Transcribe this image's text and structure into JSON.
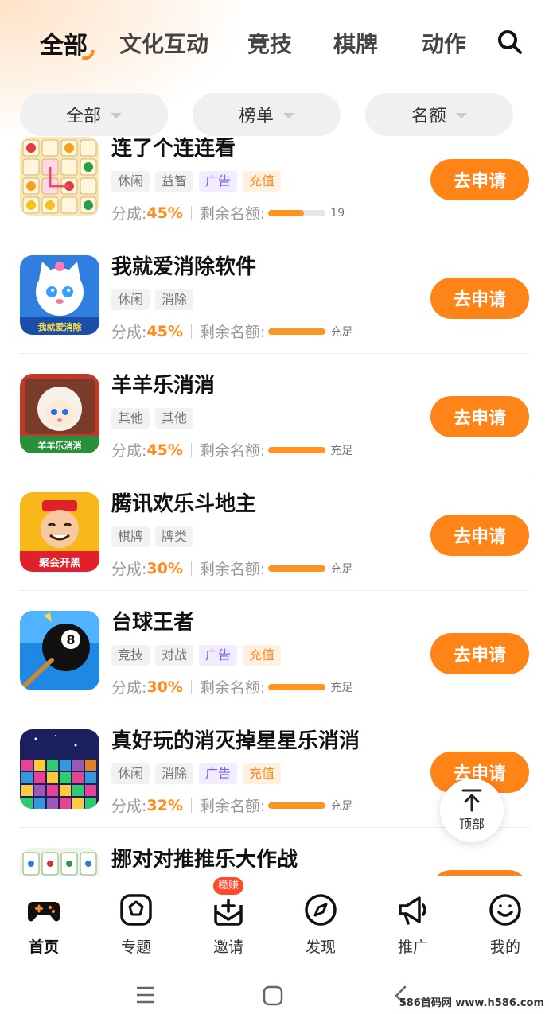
{
  "category_tabs": [
    {
      "label": "全部",
      "active": true
    },
    {
      "label": "文化互动",
      "active": false
    },
    {
      "label": "竞技",
      "active": false
    },
    {
      "label": "棋牌",
      "active": false
    },
    {
      "label": "动作",
      "active": false
    }
  ],
  "filters": [
    {
      "label": "全部"
    },
    {
      "label": "榜单"
    },
    {
      "label": "名额"
    }
  ],
  "meta_labels": {
    "share": "分成:",
    "quota": "剩余名额:"
  },
  "apply_label": "去申请",
  "games": [
    {
      "name": "连了个连连看",
      "icon": "link-match-game-icon",
      "tags": [
        {
          "text": "休闲",
          "type": "normal"
        },
        {
          "text": "益智",
          "type": "normal"
        },
        {
          "text": "广告",
          "type": "ad"
        },
        {
          "text": "充值",
          "type": "charge"
        }
      ],
      "share": "45%",
      "quota_fill": 0.62,
      "quota_text": "19"
    },
    {
      "name": "我就爱消除软件",
      "icon": "cat-elimination-game-icon",
      "tags": [
        {
          "text": "休闲",
          "type": "normal"
        },
        {
          "text": "消除",
          "type": "normal"
        }
      ],
      "share": "45%",
      "quota_fill": 1.0,
      "quota_text": "充足"
    },
    {
      "name": "羊羊乐消消",
      "icon": "sheep-elimination-game-icon",
      "tags": [
        {
          "text": "其他",
          "type": "normal"
        },
        {
          "text": "其他",
          "type": "normal"
        }
      ],
      "share": "45%",
      "quota_fill": 1.0,
      "quota_text": "充足"
    },
    {
      "name": "腾讯欢乐斗地主",
      "icon": "doudizhu-game-icon",
      "tags": [
        {
          "text": "棋牌",
          "type": "normal"
        },
        {
          "text": "牌类",
          "type": "normal"
        }
      ],
      "share": "30%",
      "quota_fill": 1.0,
      "quota_text": "充足"
    },
    {
      "name": "台球王者",
      "icon": "billiards-game-icon",
      "tags": [
        {
          "text": "竞技",
          "type": "normal"
        },
        {
          "text": "对战",
          "type": "normal"
        },
        {
          "text": "广告",
          "type": "ad"
        },
        {
          "text": "充值",
          "type": "charge"
        }
      ],
      "share": "30%",
      "quota_fill": 1.0,
      "quota_text": "充足"
    },
    {
      "name": "真好玩的消灭掉星星乐消消",
      "icon": "star-blocks-game-icon",
      "tags": [
        {
          "text": "休闲",
          "type": "normal"
        },
        {
          "text": "消除",
          "type": "normal"
        },
        {
          "text": "广告",
          "type": "ad"
        },
        {
          "text": "充值",
          "type": "charge"
        }
      ],
      "share": "32%",
      "quota_fill": 1.0,
      "quota_text": "充足"
    },
    {
      "name": "挪对对推推乐大作战",
      "icon": "mahjong-game-icon",
      "tags": [],
      "share": "",
      "quota_fill": 0,
      "quota_text": ""
    }
  ],
  "icon_text": {
    "cat": "我就爱消除",
    "sheep": "羊羊乐消消",
    "doudizhu": "聚会开黑"
  },
  "back_to_top": {
    "label": "顶部",
    "icon": "arrow-up-icon"
  },
  "bottom_nav": [
    {
      "label": "首页",
      "icon": "gamepad-icon",
      "active": true
    },
    {
      "label": "专题",
      "icon": "topic-icon",
      "active": false
    },
    {
      "label": "邀请",
      "icon": "invite-icon",
      "active": false,
      "badge": "稳赚"
    },
    {
      "label": "发现",
      "icon": "compass-icon",
      "active": false
    },
    {
      "label": "推广",
      "icon": "megaphone-icon",
      "active": false
    },
    {
      "label": "我的",
      "icon": "profile-icon",
      "active": false
    }
  ],
  "watermark": "586首码网 www.h586.com",
  "colors": {
    "accent": "#ff8418",
    "ad_tag": "#7a5cf0",
    "charge_tag": "#ff8a1a",
    "badge": "#ff4a2a"
  }
}
